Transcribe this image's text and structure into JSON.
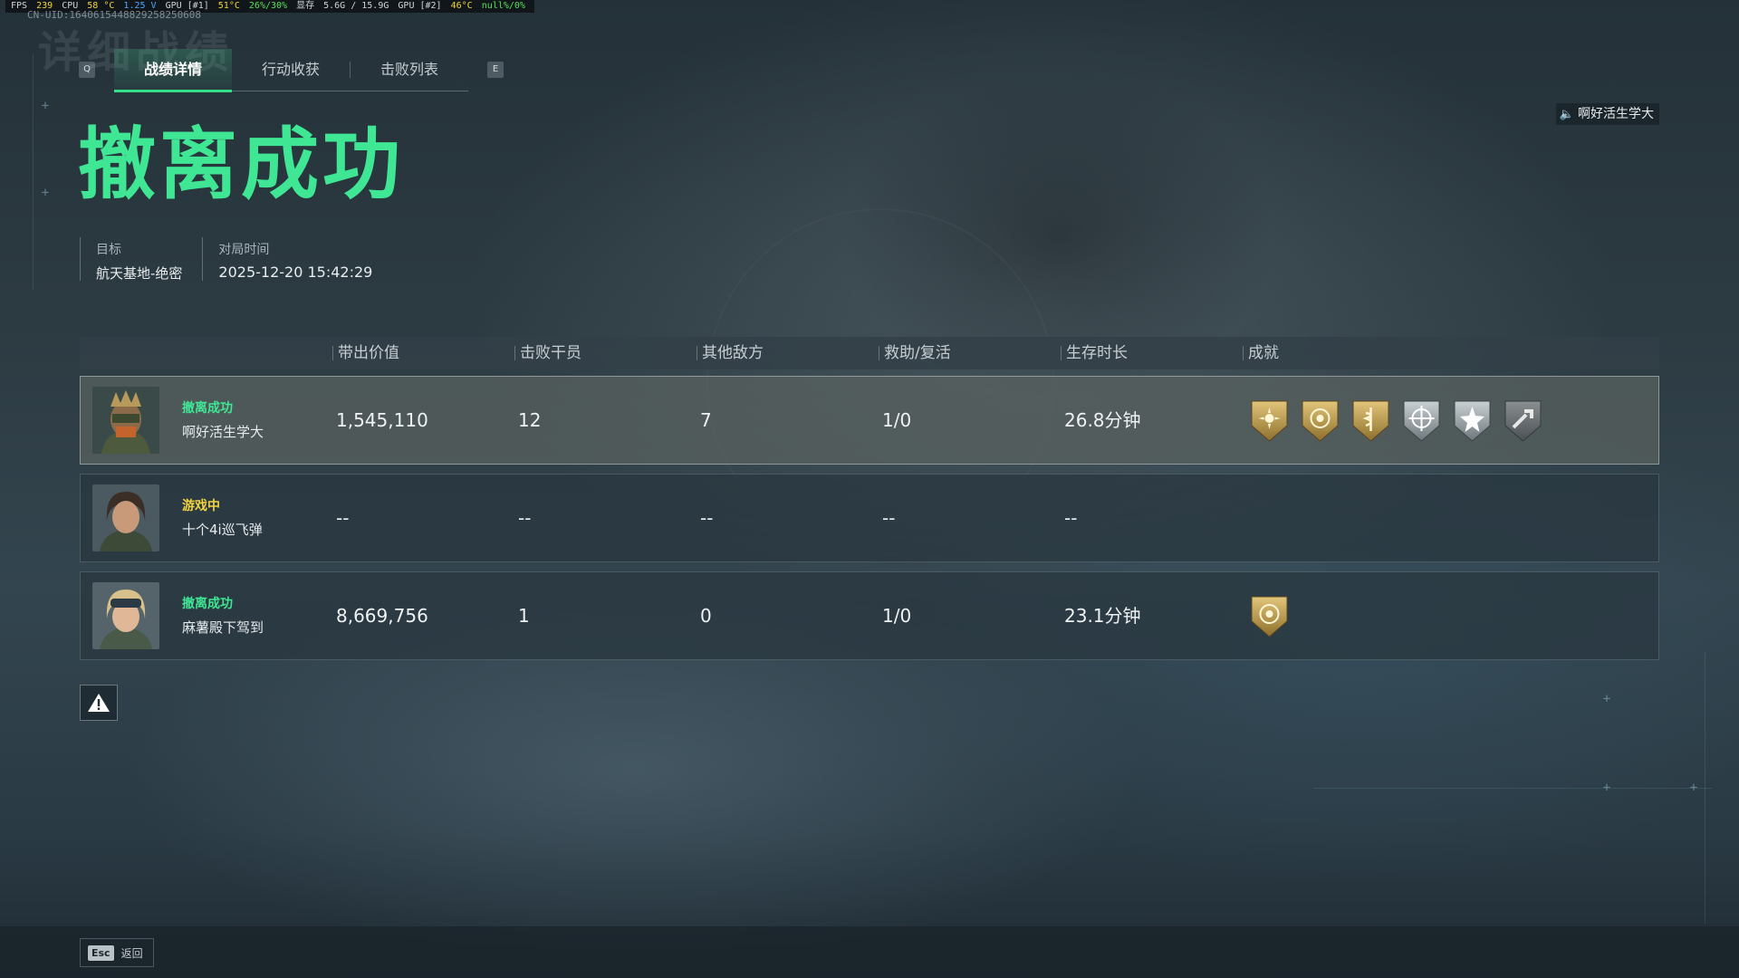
{
  "overlay": {
    "fps_label": "FPS",
    "fps": "239",
    "cpu_label": "CPU",
    "cpu_temp": "58 °C",
    "cpu_volt": "1.25 V",
    "gpu1_label": "GPU [#1]",
    "gpu1_temp": "51°C",
    "gpu1_load": "26%/30%",
    "vram_label": "显存",
    "vram": "5.6G / 15.9G",
    "gpu2_label": "GPU [#2]",
    "gpu2_temp": "46°C",
    "gpu2_load": "null%/0%",
    "uid": "CN-UID:1640615448829258250608"
  },
  "watermark": "详细战绩",
  "tabs": {
    "left_key": "Q",
    "right_key": "E",
    "items": [
      {
        "label": "战绩详情",
        "active": true
      },
      {
        "label": "行动收获",
        "active": false
      },
      {
        "label": "击败列表",
        "active": false
      }
    ]
  },
  "voice_player": "啊好活生学大",
  "result_title": "撤离成功",
  "meta": {
    "target_label": "目标",
    "target_value": "航天基地-绝密",
    "time_label": "对局时间",
    "time_value": "2025-12-20 15:42:29"
  },
  "table": {
    "headers": [
      "带出价值",
      "击败干员",
      "其他敌方",
      "救助/复活",
      "生存时长",
      "成就"
    ],
    "rows": [
      {
        "status": "撤离成功",
        "status_color": "#3fe694",
        "name": "啊好活生学大",
        "value": "1,545,110",
        "kills": "12",
        "others": "7",
        "assist": "1/0",
        "survival": "26.8分钟",
        "badges": [
          "gold-sun-badge",
          "gold-target-badge",
          "gold-medic-badge",
          "silver-crosshair-badge",
          "silver-star-badge",
          "silver-wrench-badge"
        ]
      },
      {
        "status": "游戏中",
        "status_color": "#f1d23f",
        "name": "十个4i巡飞弹",
        "value": "--",
        "kills": "--",
        "others": "--",
        "assist": "--",
        "survival": "--",
        "badges": []
      },
      {
        "status": "撤离成功",
        "status_color": "#3fe694",
        "name": "麻薯殿下驾到",
        "value": "8,669,756",
        "kills": "1",
        "others": "0",
        "assist": "1/0",
        "survival": "23.1分钟",
        "badges": [
          "gold-target-badge"
        ]
      }
    ]
  },
  "footer": {
    "esc_key": "Esc",
    "back_label": "返回"
  },
  "colors": {
    "accent_green": "#3fe694",
    "status_yellow": "#f1d23f"
  }
}
